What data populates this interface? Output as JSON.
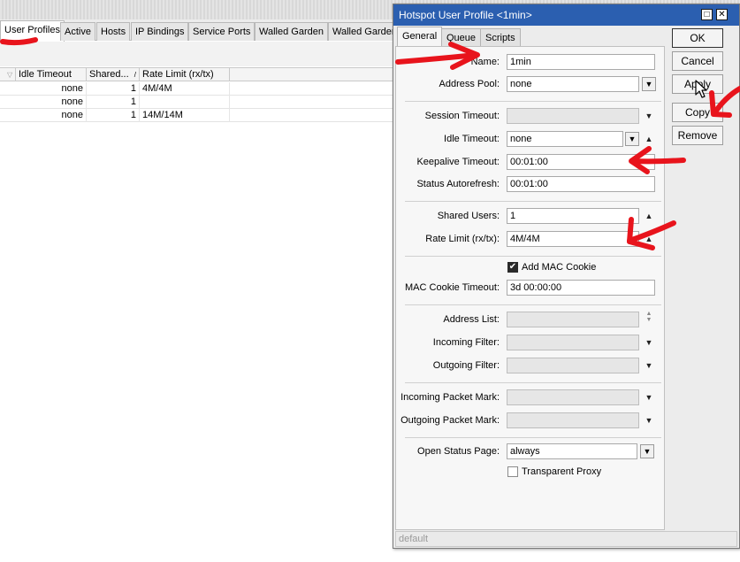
{
  "background": {
    "tabs": [
      "User Profiles",
      "Active",
      "Hosts",
      "IP Bindings",
      "Service Ports",
      "Walled Garden",
      "Walled Garden"
    ],
    "columns": [
      "Idle Timeout",
      "Shared...",
      "Rate Limit (rx/tx)"
    ],
    "rows": [
      {
        "idle": "none",
        "shared": "1",
        "rate": "4M/4M"
      },
      {
        "idle": "none",
        "shared": "1",
        "rate": ""
      },
      {
        "idle": "none",
        "shared": "1",
        "rate": "14M/14M"
      }
    ]
  },
  "dialog": {
    "title": "Hotspot User Profile <1min>",
    "tabs": [
      "General",
      "Queue",
      "Scripts"
    ],
    "buttons": {
      "ok": "OK",
      "cancel": "Cancel",
      "apply": "Apply",
      "copy": "Copy",
      "remove": "Remove"
    },
    "fields": {
      "name": {
        "label": "Name:",
        "value": "1min"
      },
      "address_pool": {
        "label": "Address Pool:",
        "value": "none"
      },
      "session_timeout": {
        "label": "Session Timeout:",
        "value": ""
      },
      "idle_timeout": {
        "label": "Idle Timeout:",
        "value": "none"
      },
      "keepalive_timeout": {
        "label": "Keepalive Timeout:",
        "value": "00:01:00"
      },
      "status_autorefresh": {
        "label": "Status Autorefresh:",
        "value": "00:01:00"
      },
      "shared_users": {
        "label": "Shared Users:",
        "value": "1"
      },
      "rate_limit": {
        "label": "Rate Limit (rx/tx):",
        "value": "4M/4M"
      },
      "add_mac_cookie": {
        "label": "Add MAC Cookie",
        "checked": true
      },
      "mac_cookie_timeout": {
        "label": "MAC Cookie Timeout:",
        "value": "3d 00:00:00"
      },
      "address_list": {
        "label": "Address List:",
        "value": ""
      },
      "incoming_filter": {
        "label": "Incoming Filter:",
        "value": ""
      },
      "outgoing_filter": {
        "label": "Outgoing Filter:",
        "value": ""
      },
      "incoming_packet_mark": {
        "label": "Incoming Packet Mark:",
        "value": ""
      },
      "outgoing_packet_mark": {
        "label": "Outgoing Packet Mark:",
        "value": ""
      },
      "open_status_page": {
        "label": "Open Status Page:",
        "value": "always"
      },
      "transparent_proxy": {
        "label": "Transparent Proxy",
        "checked": false
      }
    },
    "status": "default"
  },
  "colors": {
    "titlebar": "#2b5fb0",
    "annotation": "#e8141c"
  },
  "icons": [
    "maximize-icon",
    "close-icon",
    "dropdown-icon",
    "up-arrow-icon",
    "down-arrow-icon",
    "sort-icon",
    "mouse-cursor-icon"
  ]
}
